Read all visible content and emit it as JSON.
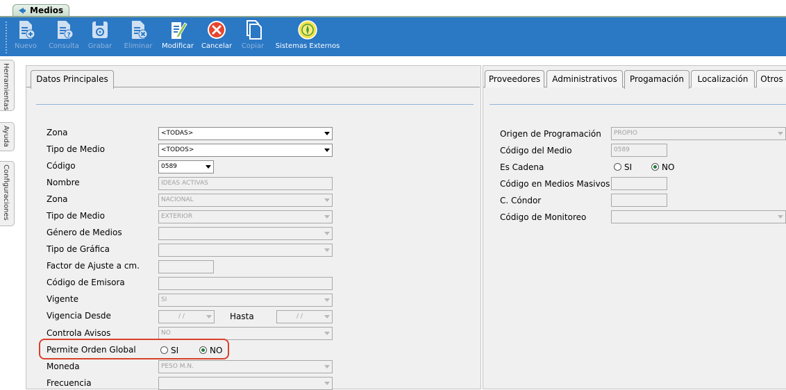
{
  "window_tab": {
    "label": "Medios"
  },
  "toolbar": [
    {
      "key": "nuevo",
      "label": "Nuevo",
      "enabled": false,
      "icon": "document-add-icon"
    },
    {
      "key": "consulta",
      "label": "Consulta",
      "enabled": false,
      "icon": "document-query-icon"
    },
    {
      "key": "grabar",
      "label": "Grabar",
      "enabled": false,
      "icon": "save-icon"
    },
    {
      "key": "eliminar",
      "label": "Eliminar",
      "enabled": false,
      "icon": "document-delete-icon"
    },
    {
      "key": "modificar",
      "label": "Modificar",
      "enabled": true,
      "icon": "edit-icon"
    },
    {
      "key": "cancelar",
      "label": "Cancelar",
      "enabled": true,
      "icon": "cancel-icon"
    },
    {
      "key": "copiar",
      "label": "Copiar",
      "enabled": false,
      "icon": "copy-icon"
    },
    {
      "key": "externos",
      "label": "Sistemas Externos",
      "enabled": true,
      "icon": "external-systems-icon"
    }
  ],
  "side_tabs": [
    "Herramientas",
    "Ayuda",
    "Configuraciones"
  ],
  "left_tab": "Datos Principales",
  "right_tabs": [
    "Proveedores",
    "Administrativos",
    "Progamación",
    "Localización",
    "Otros"
  ],
  "right_active_tab": "Progamación",
  "left_form": {
    "zona": {
      "label": "Zona",
      "value": "<TODAS>"
    },
    "tipo_medio": {
      "label": "Tipo de Medio",
      "value": "<TODOS>"
    },
    "codigo": {
      "label": "Código",
      "value": "0589"
    },
    "nombre": {
      "label": "Nombre",
      "value": "IDEAS ACTIVAS"
    },
    "zona2": {
      "label": "Zona",
      "value": "NACIONAL"
    },
    "tipo_medio2": {
      "label": "Tipo de Medio",
      "value": "EXTERIOR"
    },
    "genero": {
      "label": "Género de Medios",
      "value": ""
    },
    "tipo_grafica": {
      "label": "Tipo de Gráfica",
      "value": ""
    },
    "factor": {
      "label": "Factor de Ajuste a cm.",
      "value": ""
    },
    "emisora": {
      "label": "Código de Emisora",
      "value": ""
    },
    "vigente": {
      "label": "Vigente",
      "value": "SI"
    },
    "vigencia": {
      "label": "Vigencia Desde",
      "desde": "/ /",
      "hasta_label": "Hasta",
      "hasta": "/ /"
    },
    "avisos": {
      "label": "Controla Avisos",
      "value": "NO"
    },
    "orden_global": {
      "label": "Permite Orden Global",
      "si": "SI",
      "no": "NO",
      "selected": "NO"
    },
    "moneda": {
      "label": "Moneda",
      "value": "PESO M.N."
    },
    "frecuencia": {
      "label": "Frecuencia",
      "value": ""
    }
  },
  "right_form": {
    "origen": {
      "label": "Origen de Programación",
      "value": "PROPIO"
    },
    "codigo_medio": {
      "label": "Código del Medio",
      "value": "0589"
    },
    "cadena": {
      "label": "Es Cadena",
      "si": "SI",
      "no": "NO",
      "selected": "NO"
    },
    "masivos": {
      "label": "Código en Medios Masivos",
      "value": ""
    },
    "condor": {
      "label": "C. Cóndor",
      "value": ""
    },
    "monitoreo": {
      "label": "Código de Monitoreo",
      "value": ""
    }
  },
  "colors": {
    "toolbar": "#2b78c5",
    "highlight": "#d9402b",
    "radio_selected": "#1f7a3a"
  }
}
